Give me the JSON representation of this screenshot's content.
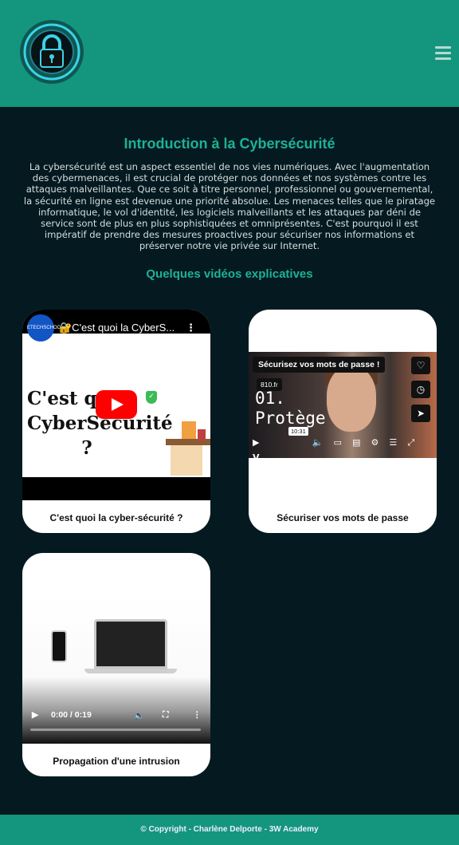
{
  "header": {
    "logo_icon": "padlock-circuit-logo",
    "menu_icon": "hamburger-menu-icon"
  },
  "main": {
    "title": "Introduction à la Cybersécurité",
    "intro": "La cybersécurité est un aspect essentiel de nos vies numériques. Avec l'augmentation des cybermenaces, il est crucial de protéger nos données et nos systèmes contre les attaques malveillantes. Que ce soit à titre personnel, professionnel ou gouvernemental, la sécurité en ligne est devenue une priorité absolue. Les menaces telles que le piratage informatique, le vol d'identité, les logiciels malveillants et les attaques par déni de service sont de plus en plus sophistiquées et omniprésentes. C'est pourquoi il est impératif de prendre des mesures proactives pour sécuriser nos informations et préserver notre vie privée sur Internet.",
    "videos_heading": "Quelques vidéos explicatives",
    "videos": [
      {
        "caption": "C'est quoi la cyber-sécurité ?",
        "channel": "ETECHSCHOOL",
        "player_title": "🔐C'est quoi la CyberS...",
        "thumb_line1": "C'est quoi",
        "thumb_line2": "CyberSécurité",
        "thumb_line3": "?"
      },
      {
        "caption": "Sécuriser vos mots de passe",
        "banner": "Sécurisez vos mots de passe !",
        "site": "810.fr",
        "thumb_line1": "01.",
        "thumb_line2": "Protège",
        "timestamp": "10:31"
      },
      {
        "caption": "Propagation d'une intrusion",
        "time": "0:00 / 0:19"
      }
    ]
  },
  "footer": {
    "text": "© Copyright - Charlène Delporte - 3W Academy"
  },
  "colors": {
    "header_bg": "#14967e",
    "page_bg": "#041a20",
    "accent": "#1fb196"
  }
}
